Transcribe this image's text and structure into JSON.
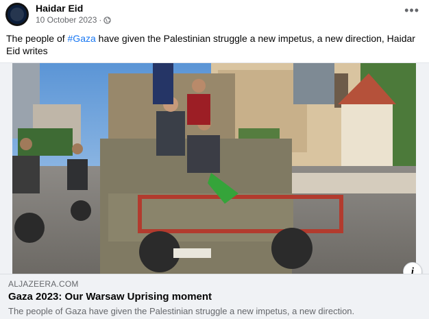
{
  "post": {
    "author": "Haidar Eid",
    "date": "10 October 2023",
    "separator": "·",
    "visibility_icon": "globe-icon",
    "more_label": "•••",
    "text_before": "The people of ",
    "hashtag": "#Gaza",
    "text_after": " have given the Palestinian struggle a new impetus, a new direction, Haidar Eid writes"
  },
  "link_preview": {
    "domain": "ALJAZEERA.COM",
    "title": "Gaza 2023: Our Warsaw Uprising moment",
    "description": "The people of Gaza have given the Palestinian struggle a new impetus, a new direction.",
    "info_label": "i"
  }
}
